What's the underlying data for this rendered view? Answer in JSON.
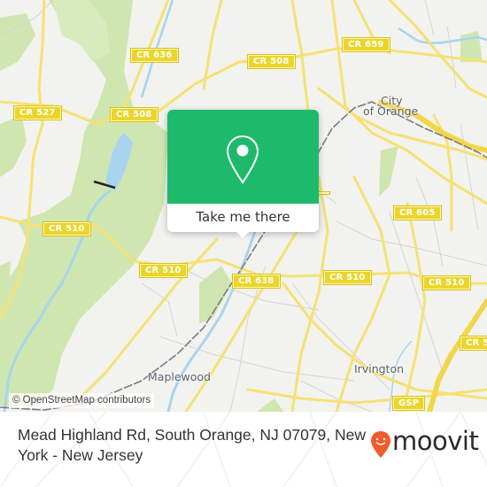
{
  "map": {
    "road_labels": [
      {
        "id": "cr636",
        "text": "CR 636"
      },
      {
        "id": "cr508-west",
        "text": "CR 508"
      },
      {
        "id": "cr508-east",
        "text": "CR 508"
      },
      {
        "id": "cr527",
        "text": "CR 527"
      },
      {
        "id": "cr659",
        "text": "CR 659"
      },
      {
        "id": "cr510-west",
        "text": "CR 510"
      },
      {
        "id": "cr510-mid",
        "text": "CR 510"
      },
      {
        "id": "cr638",
        "text": "CR 638"
      },
      {
        "id": "cr510-east1",
        "text": "CR 510"
      },
      {
        "id": "cr510-east2",
        "text": "CR 510"
      },
      {
        "id": "cr510-east3",
        "text": "CR 5"
      },
      {
        "id": "cr605",
        "text": "CR 605"
      },
      {
        "id": "gsp",
        "text": "GSP"
      }
    ],
    "place_labels": {
      "city_of_orange_line1": "City",
      "city_of_orange_line2": "of Orange",
      "maplewood": "Maplewood",
      "irvington": "Irvington"
    },
    "attribution": "© OpenStreetMap contributors",
    "colors": {
      "land": "#f2f2ef",
      "park": "#cfe6b0",
      "water": "#a8d4ef",
      "road": "#f6e173",
      "minor_road": "#c9c9c9",
      "rail": "#777777"
    }
  },
  "popup": {
    "icon": "location-pin-icon",
    "button_label": "Take me there",
    "accent_color": "#1dba6b"
  },
  "footer": {
    "address": "Mead Highland Rd, South Orange, NJ 07079, New York - New Jersey",
    "logo_text": "moovit",
    "logo_color": "#ef5b2b"
  }
}
